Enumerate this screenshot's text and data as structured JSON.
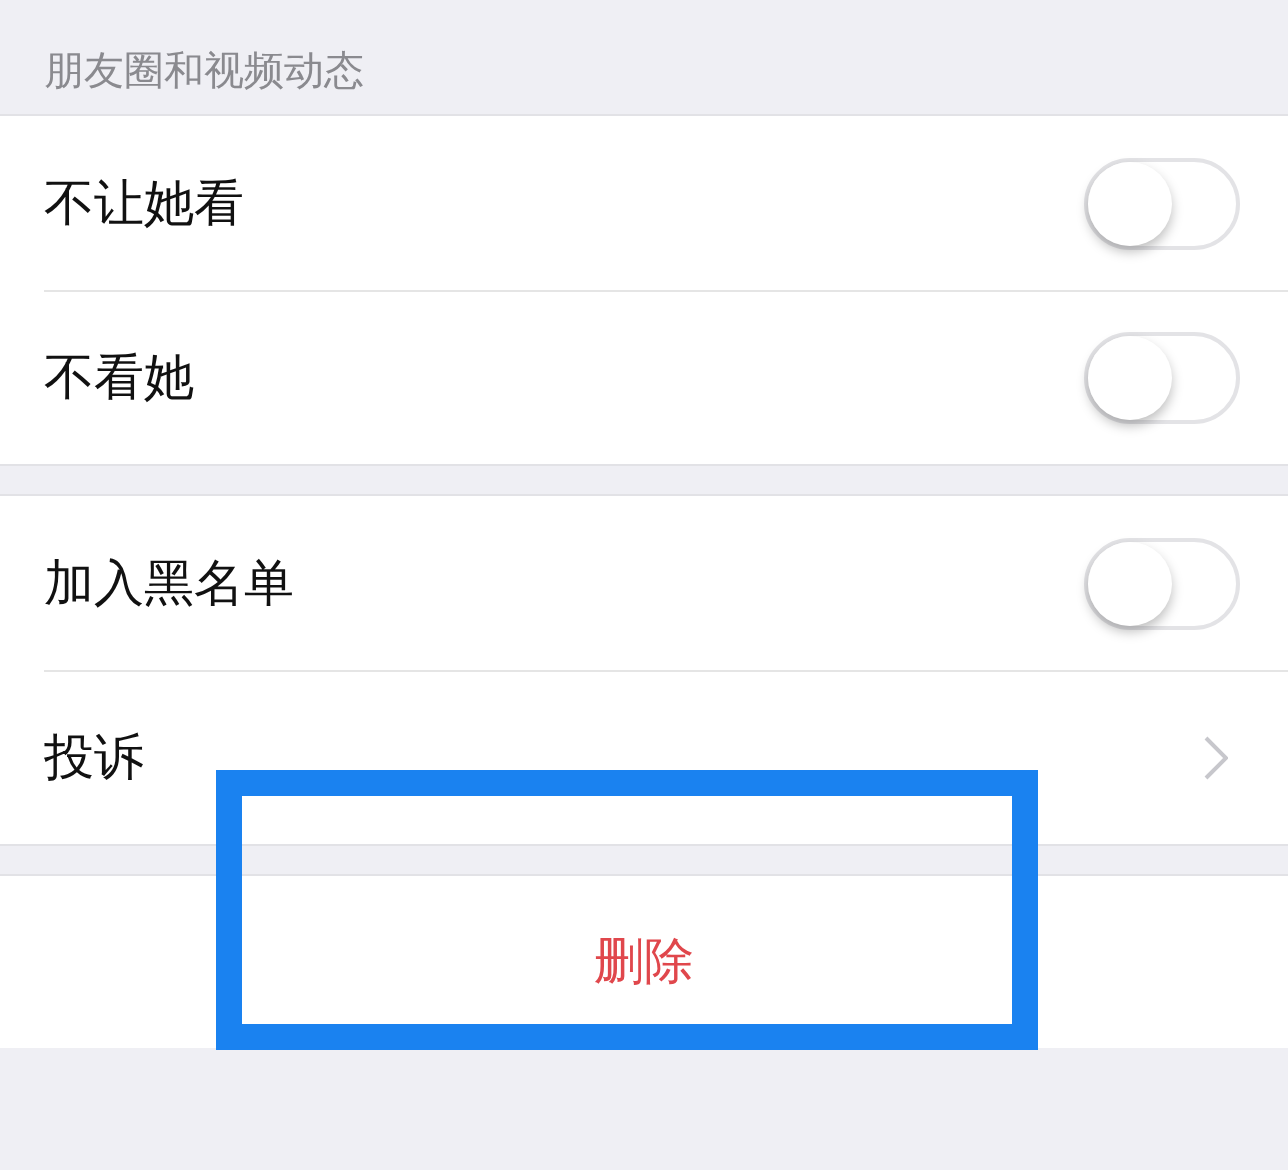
{
  "section_header": "朋友圈和视频动态",
  "groups": [
    {
      "rows": [
        {
          "kind": "toggle",
          "label": "不让她看",
          "on": false
        },
        {
          "kind": "toggle",
          "label": "不看她",
          "on": false
        }
      ]
    },
    {
      "rows": [
        {
          "kind": "toggle",
          "label": "加入黑名单",
          "on": false
        },
        {
          "kind": "link",
          "label": "投诉"
        }
      ]
    }
  ],
  "delete_button": {
    "label": "删除",
    "highlighted": true
  }
}
